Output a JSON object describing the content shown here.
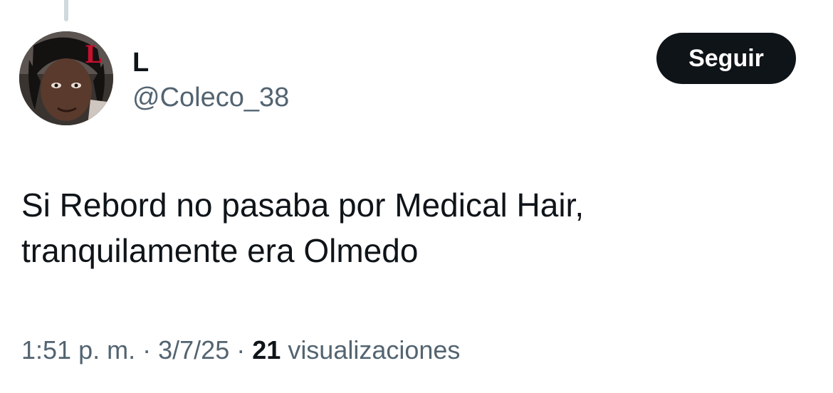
{
  "tweet": {
    "author": {
      "name": "L",
      "handle": "@Coleco_38",
      "avatar_icon": "profile-avatar-image"
    },
    "follow_label": "Seguir",
    "text_lines": [
      "Si Rebord no pasaba por Medical Hair,",
      "tranquilamente era Olmedo"
    ],
    "meta": {
      "time": "1:51 p. m.",
      "separator": "·",
      "date": "3/7/25",
      "views_count": "21",
      "views_label": "visualizaciones"
    }
  },
  "colors": {
    "primary_text": "#0f1419",
    "secondary_text": "#536471",
    "button_bg": "#0f1419",
    "button_text": "#ffffff",
    "thread_line": "#cfd9de",
    "avatar_accent": "#c8102e"
  }
}
